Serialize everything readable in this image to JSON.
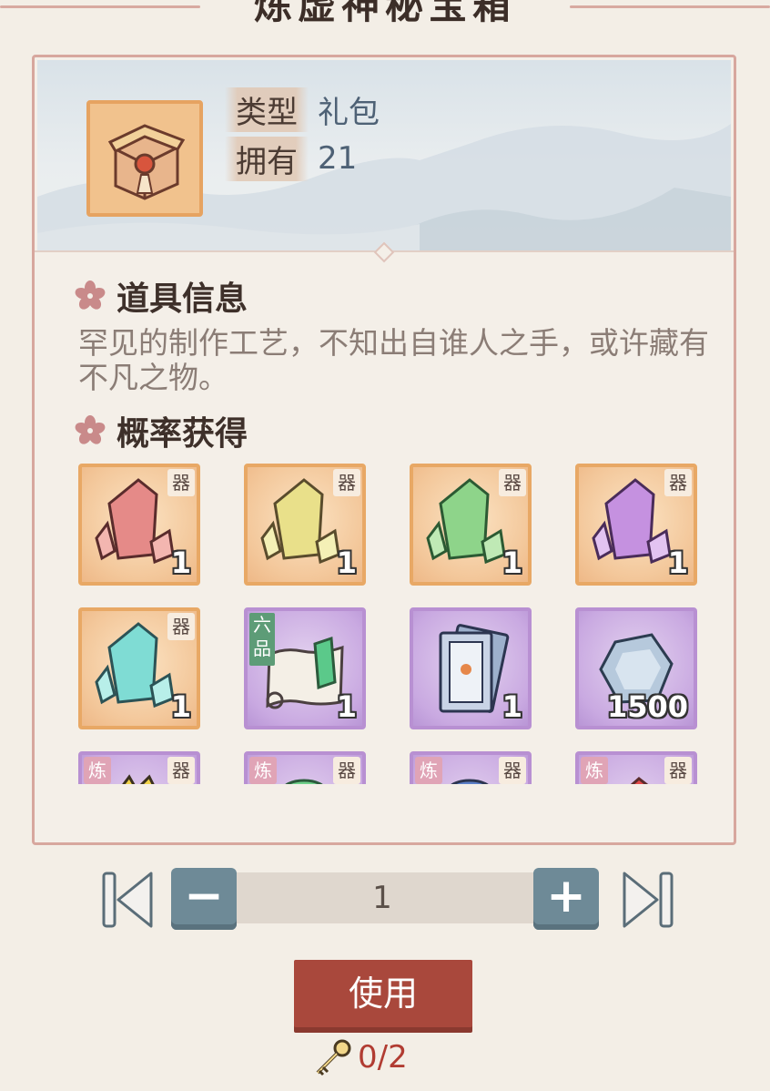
{
  "window": {
    "title": "炼虚神秘宝箱"
  },
  "item_header": {
    "icon": "treasure-chest-icon",
    "type_label": "类型",
    "type_value": "礼包",
    "owned_label": "拥有",
    "owned_value": "21"
  },
  "info_section": {
    "title": "道具信息",
    "description": "罕见的制作工艺，不知出自谁人之手，或许藏有不凡之物。"
  },
  "drops_section": {
    "title": "概率获得",
    "items": [
      {
        "name": "red-crystal-shard",
        "frame": "orange",
        "corner_tag": "器",
        "quantity": "1"
      },
      {
        "name": "yellow-crystal-shard",
        "frame": "orange",
        "corner_tag": "器",
        "quantity": "1"
      },
      {
        "name": "green-crystal-shard",
        "frame": "orange",
        "corner_tag": "器",
        "quantity": "1"
      },
      {
        "name": "purple-crystal-shard",
        "frame": "orange",
        "corner_tag": "器",
        "quantity": "1"
      },
      {
        "name": "cyan-crystal-shard",
        "frame": "orange",
        "corner_tag": "器",
        "quantity": "1"
      },
      {
        "name": "scroll-map",
        "frame": "purple",
        "left_tag": "六品",
        "quantity": "1"
      },
      {
        "name": "talisman-cards",
        "frame": "purple",
        "quantity": "1"
      },
      {
        "name": "blue-spirit-stone",
        "frame": "purple",
        "quantity": "1500"
      },
      {
        "name": "refined-item-1",
        "frame": "purple",
        "left_tag": "炼",
        "corner_tag": "器"
      },
      {
        "name": "refined-item-2",
        "frame": "purple",
        "left_tag": "炼",
        "corner_tag": "器"
      },
      {
        "name": "refined-item-3",
        "frame": "purple",
        "left_tag": "炼",
        "corner_tag": "器"
      },
      {
        "name": "refined-item-4",
        "frame": "purple",
        "left_tag": "炼",
        "corner_tag": "器"
      }
    ]
  },
  "quantity_control": {
    "value": "1",
    "minus_label": "−",
    "plus_label": "+"
  },
  "use_button": {
    "label": "使用"
  },
  "key_requirement": {
    "icon": "key-icon",
    "count": "0/2"
  },
  "colors": {
    "accent_red": "#a9483c",
    "stepper_blue": "#6e8a97",
    "frame_pink": "#d7a79e",
    "orange_rarity": "#e8a865",
    "purple_rarity": "#b890d2"
  }
}
